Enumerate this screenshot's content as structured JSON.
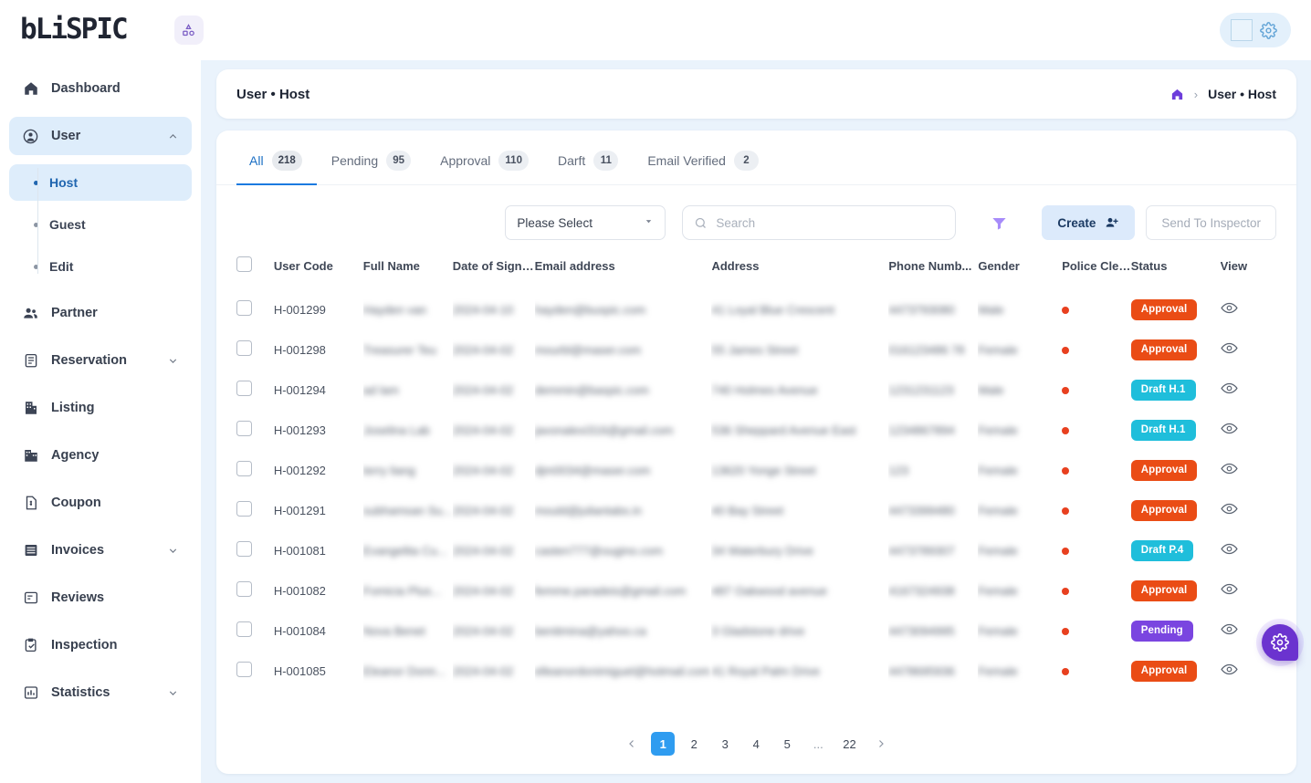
{
  "brand": {
    "logo_text": "bLiSPIC",
    "logo_mark_icon": "shapes-icon"
  },
  "topbar": {
    "avatar_icon": "avatar-placeholder",
    "settings_icon": "gear-icon"
  },
  "sidebar": {
    "items": [
      {
        "label": "Dashboard",
        "icon": "home-icon",
        "active": false,
        "expandable": false
      },
      {
        "label": "User",
        "icon": "user-circle-icon",
        "active": true,
        "expandable": true,
        "expanded": true
      },
      {
        "label": "Partner",
        "icon": "users-icon",
        "active": false,
        "expandable": false
      },
      {
        "label": "Reservation",
        "icon": "clipboard-icon",
        "active": false,
        "expandable": true
      },
      {
        "label": "Listing",
        "icon": "building-icon",
        "active": false,
        "expandable": false
      },
      {
        "label": "Agency",
        "icon": "office-icon",
        "active": false,
        "expandable": false
      },
      {
        "label": "Coupon",
        "icon": "coupon-icon",
        "active": false,
        "expandable": false
      },
      {
        "label": "Invoices",
        "icon": "invoice-icon",
        "active": false,
        "expandable": true
      },
      {
        "label": "Reviews",
        "icon": "review-icon",
        "active": false,
        "expandable": false
      },
      {
        "label": "Inspection",
        "icon": "clipboard-check-icon",
        "active": false,
        "expandable": false
      },
      {
        "label": "Statistics",
        "icon": "bar-chart-icon",
        "active": false,
        "expandable": true
      }
    ],
    "user_subitems": [
      {
        "label": "Host",
        "active": true
      },
      {
        "label": "Guest",
        "active": false
      },
      {
        "label": "Edit",
        "active": false
      }
    ]
  },
  "page": {
    "title": "User • Host",
    "breadcrumb": {
      "home_icon": "home-icon",
      "separator": "›",
      "current": "User • Host"
    }
  },
  "tabs": [
    {
      "label": "All",
      "count": "218",
      "active": true
    },
    {
      "label": "Pending",
      "count": "95",
      "active": false
    },
    {
      "label": "Approval",
      "count": "110",
      "active": false
    },
    {
      "label": "Darft",
      "count": "11",
      "active": false
    },
    {
      "label": "Email Verified",
      "count": "2",
      "active": false
    }
  ],
  "toolbar": {
    "select_value": "Please Select",
    "search_placeholder": "Search",
    "search_value": "",
    "search_icon": "search-icon",
    "filter_icon": "filter-icon",
    "create_label": "Create",
    "create_icon": "user-plus-icon",
    "send_to_inspector_label": "Send To Inspector"
  },
  "table": {
    "columns": [
      "User Code",
      "Full Name",
      "Date of Sign ...",
      "Email address",
      "Address",
      "Phone Numb...",
      "Gender",
      "Police Clear...",
      "Status",
      "View"
    ],
    "rows": [
      {
        "user_code": "H-001299",
        "full_name": "Hayden van",
        "date_of_sign": "2024-04-10",
        "email": "hayden@buspic.com",
        "address": "41 Loyal Blue Crescent",
        "phone": "4473793080",
        "gender": "Male",
        "police_clearance": "pending-dot",
        "status": "Approval",
        "status_type": "approval",
        "view_icon": "eye-icon"
      },
      {
        "user_code": "H-001298",
        "full_name": "Treasurer Teu",
        "date_of_sign": "2024-04-02",
        "email": "mourbl@maser.com",
        "address": "55 James Street",
        "phone": "016123486 78",
        "gender": "Female",
        "police_clearance": "pending-dot",
        "status": "Approval",
        "status_type": "approval",
        "view_icon": "eye-icon"
      },
      {
        "user_code": "H-001294",
        "full_name": "ad lam",
        "date_of_sign": "2024-04-02",
        "email": "demmin@baspic.com",
        "address": "740 Holmes Avenue",
        "phone": "1231231123",
        "gender": "Male",
        "police_clearance": "pending-dot",
        "status": "Draft H.1",
        "status_type": "draft",
        "view_icon": "eye-icon"
      },
      {
        "user_code": "H-001293",
        "full_name": "Joselina Lab",
        "date_of_sign": "2024-04-02",
        "email": "javonalexi316@gmail.com",
        "address": "536 Sheppard Avenue East",
        "phone": "1234867894",
        "gender": "Female",
        "police_clearance": "pending-dot",
        "status": "Draft H.1",
        "status_type": "draft",
        "view_icon": "eye-icon"
      },
      {
        "user_code": "H-001292",
        "full_name": "terry liang",
        "date_of_sign": "2024-04-02",
        "email": "djm0034@maser.com",
        "address": "13620 Yonge Street",
        "phone": "123",
        "gender": "Female",
        "police_clearance": "pending-dot",
        "status": "Approval",
        "status_type": "approval",
        "view_icon": "eye-icon"
      },
      {
        "user_code": "H-001291",
        "full_name": "subhamsan Su...",
        "date_of_sign": "2024-04-02",
        "email": "mould@juliantabs.in",
        "address": "40 Bay Street",
        "phone": "4473399480",
        "gender": "Female",
        "police_clearance": "pending-dot",
        "status": "Approval",
        "status_type": "approval",
        "view_icon": "eye-icon"
      },
      {
        "user_code": "H-001081",
        "full_name": "Evangelita Cu...",
        "date_of_sign": "2024-04-02",
        "email": "casten777@ougino.com",
        "address": "34 Waterbury Drive",
        "phone": "4473789307",
        "gender": "Female",
        "police_clearance": "pending-dot",
        "status": "Draft P.4",
        "status_type": "draft",
        "view_icon": "eye-icon"
      },
      {
        "user_code": "H-001082",
        "full_name": "Fomicia Plus...",
        "date_of_sign": "2024-04-02",
        "email": "femme.paradeis@gmail.com",
        "address": "487 Oakwood avenue",
        "phone": "4167324938",
        "gender": "Female",
        "police_clearance": "pending-dot",
        "status": "Approval",
        "status_type": "approval",
        "view_icon": "eye-icon"
      },
      {
        "user_code": "H-001084",
        "full_name": "Nova Benet",
        "date_of_sign": "2024-04-02",
        "email": "benitmina@yahoo.ca",
        "address": "3 Gladstone drive",
        "phone": "4473094995",
        "gender": "Female",
        "police_clearance": "pending-dot",
        "status": "Pending",
        "status_type": "pending",
        "view_icon": "eye-icon"
      },
      {
        "user_code": "H-001085",
        "full_name": "Eleanor Donn...",
        "date_of_sign": "2024-04-02",
        "email": "elleanordonimiguel@hotmail.com",
        "address": "41 Royal Palm Drive",
        "phone": "4478695936",
        "gender": "Female",
        "police_clearance": "pending-dot",
        "status": "Approval",
        "status_type": "approval",
        "view_icon": "eye-icon"
      }
    ]
  },
  "pagination": {
    "prev_icon": "chevron-left-icon",
    "next_icon": "chevron-right-icon",
    "pages": [
      "1",
      "2",
      "3",
      "4",
      "5",
      "...",
      "22"
    ],
    "current": "1"
  },
  "fab": {
    "icon": "gear-icon"
  },
  "colors": {
    "accent_blue": "#2f9cf0",
    "sidebar_active": "#deedfb",
    "main_bg": "#eaf3fc",
    "status_approval": "#ea4c15",
    "status_draft": "#1fbedb",
    "status_pending": "#7a45e0",
    "police_dot": "#e8401f",
    "fab_purple": "#6b33cf"
  }
}
